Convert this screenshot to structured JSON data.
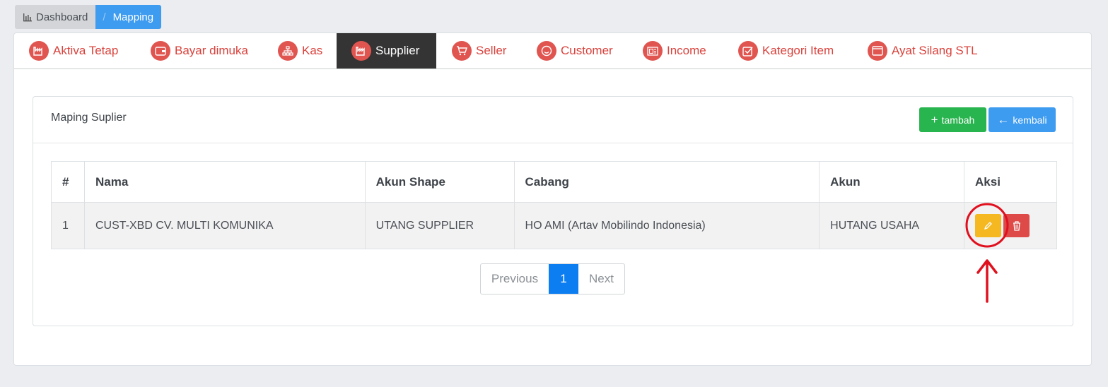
{
  "breadcrumb": {
    "dashboard": "Dashboard",
    "separator": "/",
    "current": "Mapping"
  },
  "tabs": [
    {
      "label": "Aktiva Tetap",
      "icon": "factory-icon"
    },
    {
      "label": "Bayar dimuka",
      "icon": "wallet-icon"
    },
    {
      "label": "Kas",
      "icon": "sitemap-icon"
    },
    {
      "label": "Supplier",
      "icon": "factory-icon",
      "active": true
    },
    {
      "label": "Seller",
      "icon": "cart-icon"
    },
    {
      "label": "Customer",
      "icon": "smile-icon"
    },
    {
      "label": "Income",
      "icon": "money-icon"
    },
    {
      "label": "Kategori Item",
      "icon": "checkbox-icon"
    },
    {
      "label": "Ayat Silang STL",
      "icon": "window-icon"
    }
  ],
  "panel": {
    "title": "Maping Suplier",
    "add_label": "tambah",
    "back_label": "kembali"
  },
  "table": {
    "headers": [
      "#",
      "Nama",
      "Akun Shape",
      "Cabang",
      "Akun",
      "Aksi"
    ],
    "rows": [
      [
        "1",
        "CUST-XBD CV. MULTI KOMUNIKA",
        "UTANG SUPPLIER",
        "HO AMI (Artav Mobilindo Indonesia)",
        "HUTANG USAHA"
      ]
    ]
  },
  "pagination": {
    "previous": "Previous",
    "page": "1",
    "next": "Next"
  },
  "colors": {
    "accent": "#3d9bf0",
    "tab_text": "#d9423c",
    "active_tab": "#343434",
    "edit": "#f6b820",
    "delete": "#dd4a48",
    "add": "#28b44e",
    "annotation": "#e0101e"
  }
}
